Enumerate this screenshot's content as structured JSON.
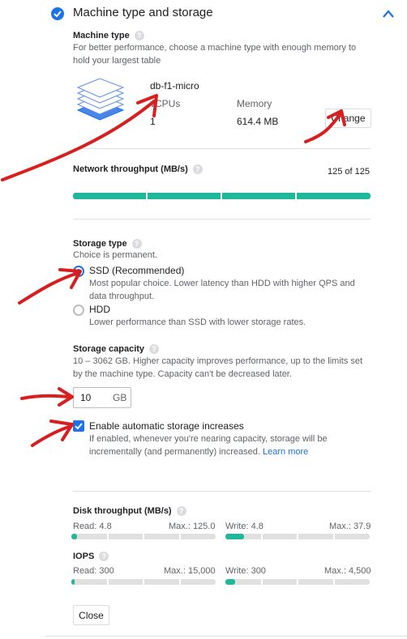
{
  "section": {
    "title": "Machine type and storage"
  },
  "machine_type": {
    "label": "Machine type",
    "description": "For better performance, choose a machine type with enough memory to hold your largest table",
    "name": "db-f1-micro",
    "vcpus_label": "vCPUs",
    "vcpus_value": "1",
    "memory_label": "Memory",
    "memory_value": "614.4 MB",
    "change_label": "Change"
  },
  "network": {
    "label": "Network throughput (MB/s)",
    "value_text": "125 of 125",
    "fill": 1.0
  },
  "storage_type": {
    "label": "Storage type",
    "note": "Choice is permanent.",
    "ssd_label": "SSD (Recommended)",
    "ssd_desc": "Most popular choice. Lower latency than HDD with higher QPS and data throughput.",
    "hdd_label": "HDD",
    "hdd_desc": "Lower performance than SSD with lower storage rates.",
    "selected": "SSD"
  },
  "storage_capacity": {
    "label": "Storage capacity",
    "desc": "10 – 3062 GB. Higher capacity improves performance, up to the limits set by the machine type. Capacity can't be decreased later.",
    "value": "10",
    "unit": "GB"
  },
  "auto_increase": {
    "label": "Enable automatic storage increases",
    "desc": "If enabled, whenever you're nearing capacity, storage will be incrementally (and permanently) increased.",
    "link": "Learn more",
    "checked": true
  },
  "disk": {
    "label": "Disk throughput (MB/s)",
    "read_label": "Read: 4.8",
    "read_max": "Max.: 125.0",
    "read_fill": 0.04,
    "write_label": "Write: 4.8",
    "write_max": "Max.: 37.9",
    "write_fill": 0.13
  },
  "iops": {
    "label": "IOPS",
    "read_label": "Read: 300",
    "read_max": "Max.: 15,000",
    "read_fill": 0.02,
    "write_label": "Write: 300",
    "write_max": "Max.: 4,500",
    "write_fill": 0.07
  },
  "close_label": "Close",
  "colors": {
    "accent": "#1a73e8",
    "bar": "#1fb89a",
    "annotation": "#d81e1e"
  }
}
